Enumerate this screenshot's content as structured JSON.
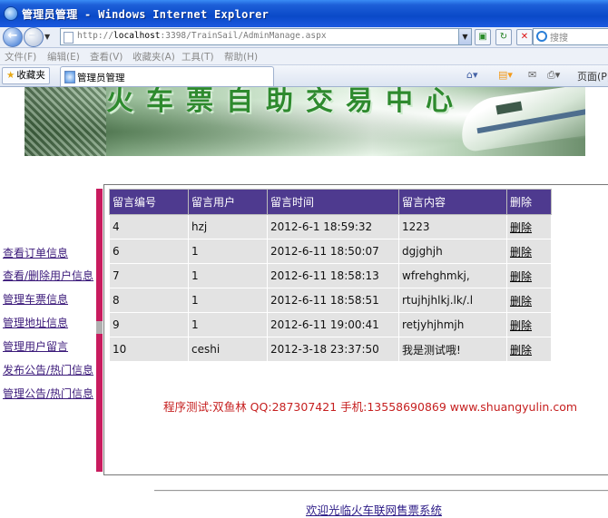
{
  "window": {
    "title": "管理员管理 - Windows Internet Explorer"
  },
  "addressbar": {
    "url_prefix": "http://",
    "url_host": "localhost",
    "url_rest": ":3398/TrainSail/AdminManage.aspx",
    "search_placeholder": "搜搜"
  },
  "menu": {
    "items": [
      "文件(F)",
      "编辑(E)",
      "查看(V)",
      "收藏夹(A)",
      "工具(T)",
      "帮助(H)"
    ]
  },
  "tabsbar": {
    "favorites_label": "收藏夹",
    "tab_title": "管理员管理",
    "page_label": "页面(P)"
  },
  "banner": {
    "title": "火车票自助交易中心"
  },
  "sidebar": {
    "links": [
      "查看订单信息",
      "查看/删除用户信息",
      "管理车票信息",
      "管理地址信息",
      "管理用户留言",
      "发布公告/热门信息",
      "管理公告/热门信息"
    ]
  },
  "table": {
    "headers": [
      "留言编号",
      "留言用户",
      "留言时间",
      "留言内容",
      "删除"
    ],
    "rows": [
      {
        "id": "4",
        "user": "hzj",
        "time": "2012-6-1 18:59:32",
        "content": "1223",
        "action": "删除"
      },
      {
        "id": "6",
        "user": "1",
        "time": "2012-6-11 18:50:07",
        "content": "dgjghjh",
        "action": "删除"
      },
      {
        "id": "7",
        "user": "1",
        "time": "2012-6-11 18:58:13",
        "content": "wfrehghmkj,",
        "action": "删除"
      },
      {
        "id": "8",
        "user": "1",
        "time": "2012-6-11 18:58:51",
        "content": "rtujhjhlkj.lk/.l",
        "action": "删除"
      },
      {
        "id": "9",
        "user": "1",
        "time": "2012-6-11 19:00:41",
        "content": "retjyhjhmjh",
        "action": "删除"
      },
      {
        "id": "10",
        "user": "ceshi",
        "time": "2012-3-18 23:37:50",
        "content": "我是测试哦!",
        "action": "删除"
      }
    ]
  },
  "footer": {
    "info": "程序测试:双鱼林 QQ:287307421 手机:13558690869 www.shuangyulin.com",
    "welcome": "欢迎光临火车联网售票系统"
  }
}
